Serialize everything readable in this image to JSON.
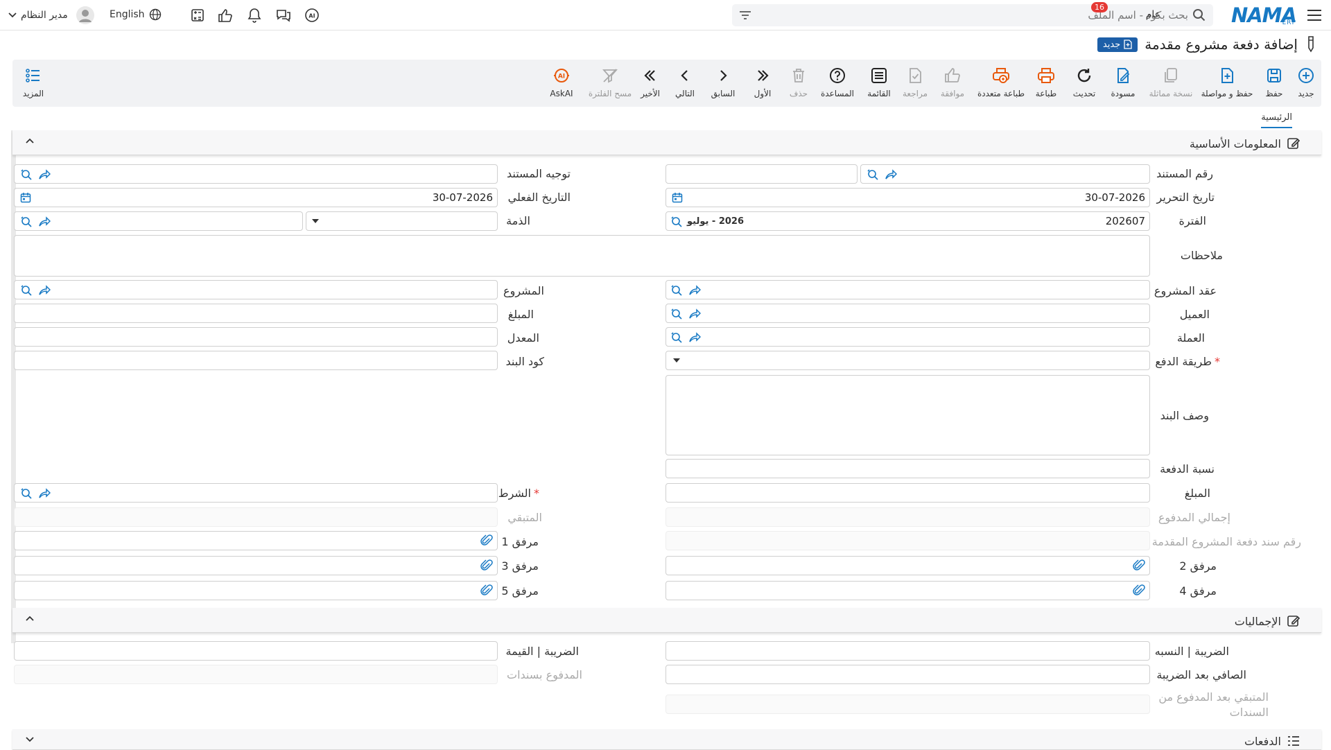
{
  "topbar": {
    "logo": "NAMA",
    "logo_sub": "ERP",
    "search_placeholder": "بحث بكود - اسم الملف",
    "badge_count": "16",
    "general_label": "عام",
    "language": "English",
    "user_name": "مدير النظام",
    "icons": [
      "menu-icon",
      "filter-icon",
      "search-icon",
      "ai-chat-icon",
      "chat-icon",
      "bell-icon",
      "like-icon",
      "calculator-icon",
      "globe-icon",
      "user-avatar-icon",
      "chevron-down-icon"
    ]
  },
  "page": {
    "title": "إضافة دفعة مشروع مقدمة",
    "new_badge": "جديد"
  },
  "toolbar": {
    "new": "جديد",
    "save": "حفظ",
    "save_continue": "حفظ و مواصلة",
    "clone": "نسخة مماثلة",
    "draft": "مسودة",
    "refresh": "تحديث",
    "print": "طباعة",
    "multi_print": "طباعة متعددة",
    "approve": "موافقة",
    "review": "مراجعة",
    "list": "القائمة",
    "help": "المساعدة",
    "delete": "حذف",
    "first": "الأول",
    "previous": "السابق",
    "next": "التالي",
    "last": "الأخير",
    "clear_filter": "مسح الفلترة",
    "askai": "AskAI",
    "more": "المزيد"
  },
  "tabs": {
    "main": "الرئيسية"
  },
  "sections": {
    "basic": "المعلومات الأساسية",
    "totals": "الإجماليات",
    "payments": "الدفعات"
  },
  "form": {
    "doc_number": "رقم المستند",
    "doc_direction": "توجيه المستند",
    "edit_date": "تاريخ التحرير",
    "edit_date_value": "30-07-2026",
    "actual_date": "التاريخ الفعلي",
    "actual_date_value": "30-07-2026",
    "period": "الفترة",
    "period_value": "202607",
    "period_name": "2026 - يوليو",
    "liability": "الذمة",
    "notes": "ملاحظات",
    "project_contract": "عقد المشروع",
    "project": "المشروع",
    "customer": "العميل",
    "amount_top": "المبلغ",
    "currency": "العملة",
    "rate": "المعدل",
    "payment_method": "طريقة الدفع",
    "item_code": "كود البند",
    "item_desc": "وصف البند",
    "payment_ratio": "نسبة الدفعة",
    "amount": "المبلغ",
    "condition": "الشرط",
    "total_paid": "إجمالي المدفوع",
    "remaining": "المتبقي",
    "voucher_number": "رقم سند دفعة المشروع المقدمة",
    "attach1": "مرفق 1",
    "attach2": "مرفق 2",
    "attach3": "مرفق 3",
    "attach4": "مرفق 4",
    "attach5": "مرفق 5"
  },
  "totals": {
    "tax_ratio": "الضريبة | النسبه",
    "tax_value": "الضريبة | القيمة",
    "net_after_tax": "الصافي بعد الضريبة",
    "paid_vouchers": "المدفوع بسندات",
    "remaining_after_paid_1": "المتبقي بعد المدفوع من",
    "remaining_after_paid_2": "السندات"
  },
  "colors": {
    "accent": "#1779c4",
    "brand_blue": "#1d5fa8",
    "print_orange": "#e8590c",
    "required_red": "#e53935"
  }
}
